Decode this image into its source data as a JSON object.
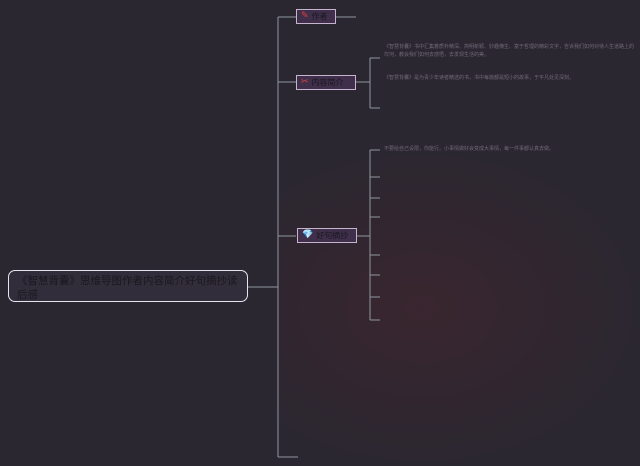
{
  "root": {
    "title": "《智慧背囊》思维导图作者内容简介好句摘抄读后感"
  },
  "branches": [
    {
      "label": "作者",
      "icon": "pen-icon",
      "icon_glyph": "✎",
      "icon_color": "#e0403a",
      "children": [
        {
          "text": ""
        }
      ]
    },
    {
      "label": "内容简介",
      "icon": "scissors-icon",
      "icon_glyph": "✂",
      "icon_color": "#e0403a",
      "children": [
        {
          "text": "《智慧背囊》书中汇集着质朴精深、简明新颖、妙趣横生、富于哲理的精彩文字，告诉我们如何对待人生道路上的坎坷，教会我们如何去感悟，去发现生活的美。"
        },
        {
          "text": "《智慧背囊》是为青少年读者精选的书，书中每篇都是短小的故事，于平凡处见深刻。"
        }
      ]
    },
    {
      "label": "好句摘抄",
      "icon": "gem-icon",
      "icon_glyph": "💎",
      "icon_color": "#f0d020",
      "children": [
        {
          "text": "不要给自己设限，你能行。小事情做好会变成大事情，每一件事都认真去做。"
        },
        {
          "text": ""
        },
        {
          "text": ""
        },
        {
          "text": ""
        },
        {
          "text": ""
        },
        {
          "text": ""
        },
        {
          "text": ""
        },
        {
          "text": ""
        },
        {
          "text": ""
        }
      ]
    }
  ]
}
